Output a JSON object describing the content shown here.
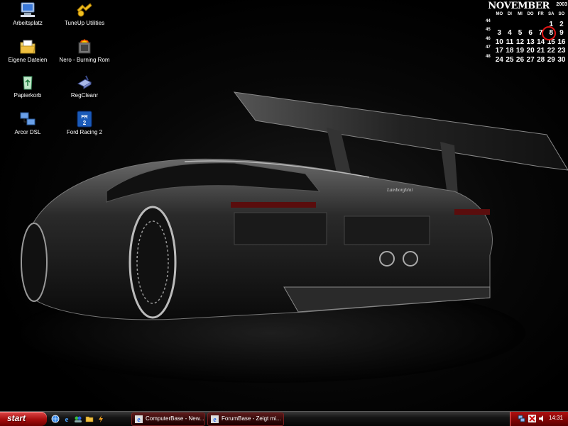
{
  "desktop_icons": [
    {
      "label": "Arbeitsplatz",
      "icon": "my-computer-icon"
    },
    {
      "label": "TuneUp Utilities",
      "icon": "tuneup-icon"
    },
    {
      "label": "Eigene Dateien",
      "icon": "my-documents-icon"
    },
    {
      "label": "Nero - Burning Rom",
      "icon": "nero-icon"
    },
    {
      "label": "Papierkorb",
      "icon": "recycle-bin-icon"
    },
    {
      "label": "RegCleanr",
      "icon": "regcleanr-icon"
    },
    {
      "label": "Arcor DSL",
      "icon": "network-icon"
    },
    {
      "label": "Ford Racing 2",
      "icon": "ford-racing-icon"
    }
  ],
  "calendar": {
    "month": "NOVEMBER",
    "year": "2003",
    "weekdays": [
      "MO",
      "DI",
      "MI",
      "DO",
      "FR",
      "SA",
      "SO"
    ],
    "weeks": [
      {
        "week": "44",
        "days": [
          "",
          "",
          "",
          "",
          "",
          "1",
          "2"
        ]
      },
      {
        "week": "45",
        "days": [
          "3",
          "4",
          "5",
          "6",
          "7",
          "8",
          "9"
        ]
      },
      {
        "week": "46",
        "days": [
          "10",
          "11",
          "12",
          "13",
          "14",
          "15",
          "16"
        ]
      },
      {
        "week": "47",
        "days": [
          "17",
          "18",
          "19",
          "20",
          "21",
          "22",
          "23"
        ]
      },
      {
        "week": "48",
        "days": [
          "24",
          "25",
          "26",
          "27",
          "28",
          "29",
          "30"
        ]
      }
    ],
    "highlighted_day": "8",
    "highlight_color": "#e01515"
  },
  "wallpaper": {
    "subject": "black Lamborghini race car rear view",
    "badge": "Lamborghini"
  },
  "taskbar": {
    "start_label": "start",
    "quick_launch": [
      "browser-icon",
      "ie-icon",
      "messenger-icon",
      "folder-icon",
      "winamp-icon"
    ],
    "tasks": [
      {
        "label": "ComputerBase - New...",
        "icon": "ie-icon"
      },
      {
        "label": "ForumBase - Zeigt mi...",
        "icon": "ie-icon"
      }
    ],
    "tray_icons": [
      "network-tray-icon",
      "antivirus-tray-icon",
      "volume-tray-icon"
    ],
    "clock": "14:31",
    "accent": "#b01010"
  }
}
